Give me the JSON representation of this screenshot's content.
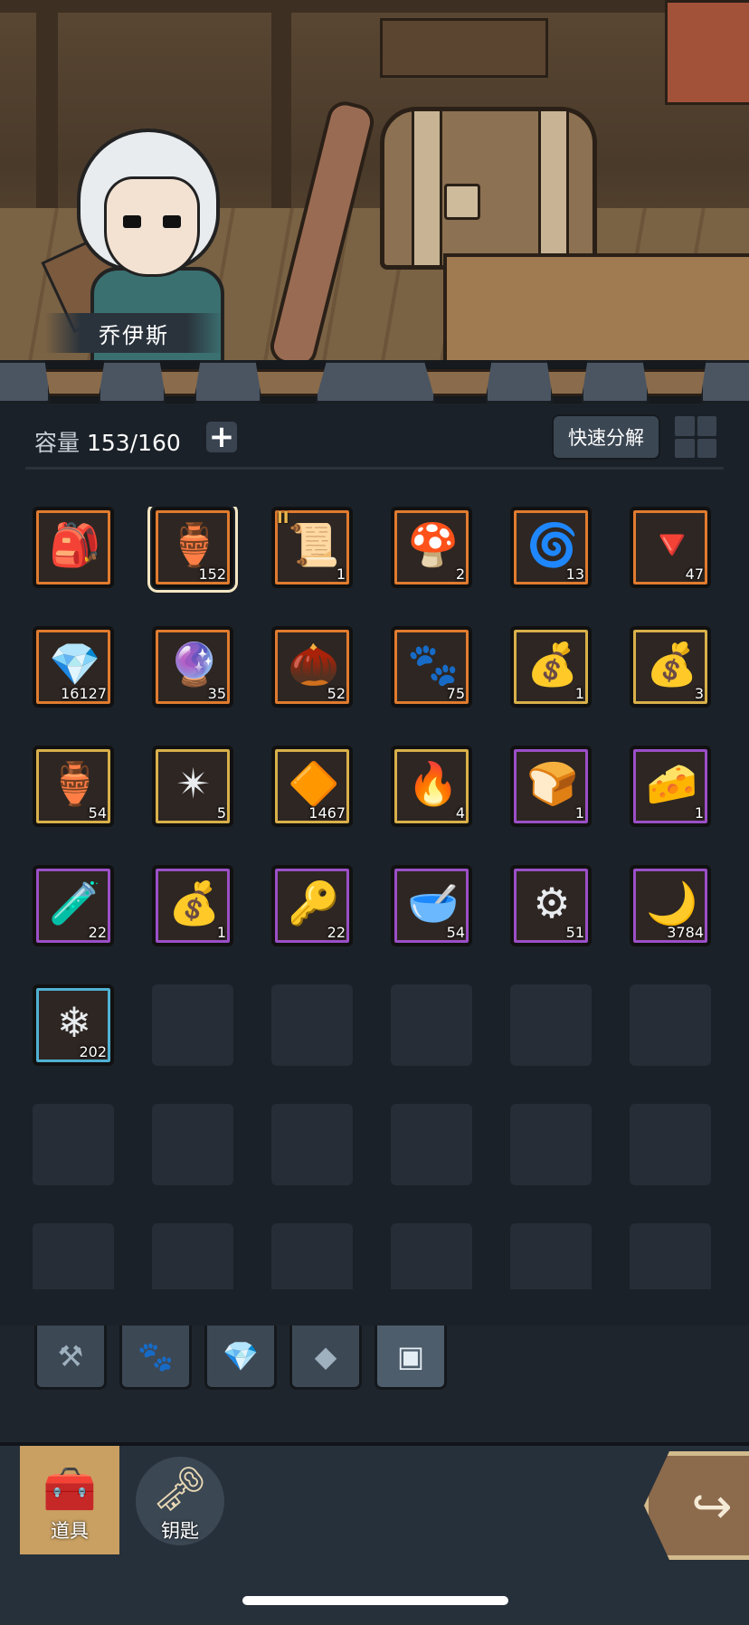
{
  "character": {
    "name": "乔伊斯"
  },
  "header": {
    "capacity_label": "容量",
    "capacity_value": "153/160",
    "add_icon": "+",
    "quick_decompose_label": "快速分解",
    "grid_toggle_icon": "grid-icon"
  },
  "rarity_colors": {
    "orange": "#e07b2f",
    "gold": "#d8b04a",
    "purple": "#9b4fc7",
    "blue": "#4fb1d3"
  },
  "items": [
    {
      "icon": "backpack-icon",
      "glyph": "🎒",
      "rarity": "orange",
      "count": ""
    },
    {
      "icon": "jar-icon",
      "glyph": "🏺",
      "rarity": "orange",
      "count": "152",
      "selected": true
    },
    {
      "icon": "scroll-icon",
      "glyph": "📜",
      "rarity": "orange",
      "count": "1",
      "tier": "II"
    },
    {
      "icon": "mushroom-icon",
      "glyph": "🍄",
      "rarity": "orange",
      "count": "2"
    },
    {
      "icon": "rune-stone-icon",
      "glyph": "🌀",
      "rarity": "orange",
      "count": "13"
    },
    {
      "icon": "red-crystal-icon",
      "glyph": "🔻",
      "rarity": "orange",
      "count": "47"
    },
    {
      "icon": "purple-crystal-icon",
      "glyph": "💎",
      "rarity": "orange",
      "count": "16127"
    },
    {
      "icon": "pink-orb-icon",
      "glyph": "🔮",
      "rarity": "orange",
      "count": "35"
    },
    {
      "icon": "seed-bag-icon",
      "glyph": "🌰",
      "rarity": "orange",
      "count": "52"
    },
    {
      "icon": "paw-gem-icon",
      "glyph": "🐾",
      "rarity": "orange",
      "count": "75"
    },
    {
      "icon": "supply-bag-icon",
      "glyph": "💰",
      "rarity": "gold",
      "count": "1"
    },
    {
      "icon": "coin-bag-icon",
      "glyph": "💰",
      "rarity": "gold",
      "count": "3"
    },
    {
      "icon": "silver-jar-icon",
      "glyph": "🏺",
      "rarity": "gold",
      "count": "54"
    },
    {
      "icon": "star-shard-icon",
      "glyph": "✴",
      "rarity": "gold",
      "count": "5"
    },
    {
      "icon": "orange-crystal-icon",
      "glyph": "🔶",
      "rarity": "gold",
      "count": "1467"
    },
    {
      "icon": "flame-icon",
      "glyph": "🔥",
      "rarity": "gold",
      "count": "4"
    },
    {
      "icon": "bread-icon",
      "glyph": "🍞",
      "rarity": "purple",
      "count": "1"
    },
    {
      "icon": "cheese-icon",
      "glyph": "🧀",
      "rarity": "purple",
      "count": "1"
    },
    {
      "icon": "potion-icon",
      "glyph": "🧪",
      "rarity": "purple",
      "count": "22"
    },
    {
      "icon": "supply-bag-icon",
      "glyph": "💰",
      "rarity": "purple",
      "count": "1"
    },
    {
      "icon": "key-icon",
      "glyph": "🔑",
      "rarity": "purple",
      "count": "22"
    },
    {
      "icon": "bowl-icon",
      "glyph": "🥣",
      "rarity": "purple",
      "count": "54"
    },
    {
      "icon": "gear-stone-icon",
      "glyph": "⚙",
      "rarity": "purple",
      "count": "51"
    },
    {
      "icon": "claw-icon",
      "glyph": "🌙",
      "rarity": "purple",
      "count": "3784"
    },
    {
      "icon": "ice-crystal-icon",
      "glyph": "❄",
      "rarity": "blue",
      "count": "202"
    }
  ],
  "category_tabs": [
    {
      "name": "equipment-tab",
      "glyph": "⚒"
    },
    {
      "name": "pet-tab",
      "glyph": "🐾"
    },
    {
      "name": "gem-tab",
      "glyph": "💎"
    },
    {
      "name": "material-tab",
      "glyph": "◆"
    },
    {
      "name": "chest-tab",
      "glyph": "▣",
      "active": true
    }
  ],
  "bottom_nav": [
    {
      "label": "道具",
      "icon": "chest-icon",
      "glyph": "🧰",
      "active": true
    },
    {
      "label": "钥匙",
      "icon": "key-icon",
      "glyph": "🗝"
    }
  ],
  "share_icon": "↪"
}
